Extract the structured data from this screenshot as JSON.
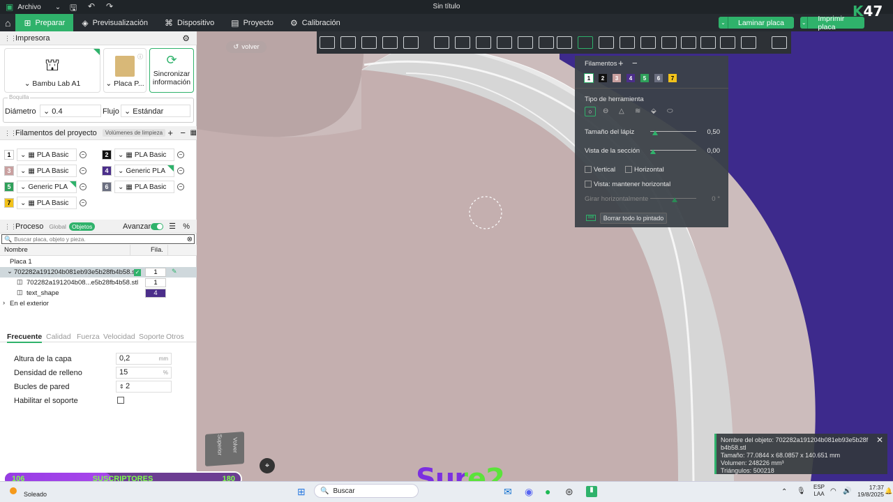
{
  "titlebar": {
    "file_menu": "Archivo",
    "title": "Sin título"
  },
  "menu": {
    "tabs": [
      {
        "label": "Preparar",
        "icon": "prepare-icon"
      },
      {
        "label": "Previsualización",
        "icon": "layers-icon"
      },
      {
        "label": "Dispositivo",
        "icon": "device-icon"
      },
      {
        "label": "Proyecto",
        "icon": "project-icon"
      },
      {
        "label": "Calibración",
        "icon": "calibration-icon"
      }
    ],
    "slice_button": "Laminar placa",
    "print_button": "Imprimir placa"
  },
  "printer": {
    "header": "Impresora",
    "printer_name": "Bambu Lab A1",
    "plate_name": "Placa P...",
    "sync_label": "Sincronizar información",
    "diameter_label": "Diámetro",
    "diameter_value": "0.4",
    "flow_label": "Flujo",
    "flow_value": "Estándar",
    "nozzle_caption": "Boquilla"
  },
  "filaments": {
    "header": "Filamentos del proyecto",
    "purge_label": "Volúmenes de limpieza",
    "items": [
      {
        "num": "1",
        "name": "PLA Basic",
        "color": "#ffffff",
        "fg": "#000000"
      },
      {
        "num": "2",
        "name": "PLA Basic",
        "color": "#111111",
        "fg": "#ffffff"
      },
      {
        "num": "3",
        "name": "PLA Basic",
        "color": "#c9a0a0",
        "fg": "#ffffff"
      },
      {
        "num": "4",
        "name": "Generic PLA",
        "color": "#4b2e8a",
        "fg": "#ffffff"
      },
      {
        "num": "5",
        "name": "Generic PLA",
        "color": "#2fa05a",
        "fg": "#ffffff"
      },
      {
        "num": "6",
        "name": "PLA Basic",
        "color": "#6b6f80",
        "fg": "#ffffff"
      },
      {
        "num": "7",
        "name": "PLA Basic",
        "color": "#f2c21b",
        "fg": "#000000"
      }
    ]
  },
  "process": {
    "header": "Proceso",
    "global_label": "Global",
    "objects_label": "Objetos",
    "advanced_label": "Avanzar",
    "search_placeholder": "Buscar placa, objeto y pieza.",
    "col_name": "Nombre",
    "col_fil": "Fila.",
    "tree": [
      {
        "label": "Placa 1",
        "value": ""
      },
      {
        "label": "702282a191204b081eb93e5b28fb4b58.stl",
        "value": "1"
      },
      {
        "label": "702282a191204b08...e5b28fb4b58.stl",
        "value": "1"
      },
      {
        "label": "text_shape",
        "value": "4"
      },
      {
        "label": "En el exterior",
        "value": ""
      }
    ]
  },
  "settings": {
    "tabs": [
      "Frecuente",
      "Calidad",
      "Fuerza",
      "Velocidad",
      "Soporte",
      "Otros"
    ],
    "rows": [
      {
        "label": "Altura de la capa",
        "value": "0,2",
        "unit": "mm"
      },
      {
        "label": "Densidad de relleno",
        "value": "15",
        "unit": "%"
      },
      {
        "label": "Bucles de pared",
        "value": "2",
        "unit": ""
      },
      {
        "label": "Habilitar el soporte",
        "value": "",
        "unit": ""
      }
    ]
  },
  "viewport": {
    "back_label": "volver",
    "cube_top": "Superior",
    "cube_front": "Volver"
  },
  "paint": {
    "filaments_label": "Filamentos",
    "swatches": [
      {
        "num": "1",
        "color": "#ffffff",
        "fg": "#000000"
      },
      {
        "num": "2",
        "color": "#111111",
        "fg": "#ffffff"
      },
      {
        "num": "3",
        "color": "#c9a0a0",
        "fg": "#ffffff"
      },
      {
        "num": "4",
        "color": "#4b2e8a",
        "fg": "#ffffff"
      },
      {
        "num": "5",
        "color": "#2fa05a",
        "fg": "#ffffff"
      },
      {
        "num": "6",
        "color": "#6b6f80",
        "fg": "#ffffff"
      },
      {
        "num": "7",
        "color": "#f2c21b",
        "fg": "#000000"
      }
    ],
    "tool_type_label": "Tipo de herramienta",
    "pen_size_label": "Tamaño del lápiz",
    "pen_size_value": "0,50",
    "pen_size_frac": 0.05,
    "section_label": "Vista de la sección",
    "section_value": "0,00",
    "section_frac": 0.0,
    "vertical_label": "Vertical",
    "horizontal_label": "Horizontal",
    "keep_horizontal_label": "Vista: mantener horizontal",
    "rotate_label": "Girar horizontalmente",
    "rotate_value": "0 °",
    "rotate_frac": 0.5,
    "clear_label": "Borrar todo lo pintado"
  },
  "info": {
    "name": "Nombre del objeto: 702282a191204b081eb93e5b28fb4b58.stl",
    "size": "Tamaño: 77.0844 x 68.0857 x 140.651 mm",
    "volume": "Volumen: 248226 mm³",
    "triangles": "Triángulos: 500218"
  },
  "overlay": {
    "sub_left": "106",
    "sub_label": "SUSCRIPTORES",
    "sub_right": "180",
    "sub_frac": 0.45,
    "brand": "Sure2",
    "corner_num": "47"
  },
  "taskbar": {
    "weather": "Soleado",
    "search": "Buscar",
    "lang": "ESP",
    "lang2": "LAA",
    "time": "17:37",
    "date": "19/8/2025"
  }
}
